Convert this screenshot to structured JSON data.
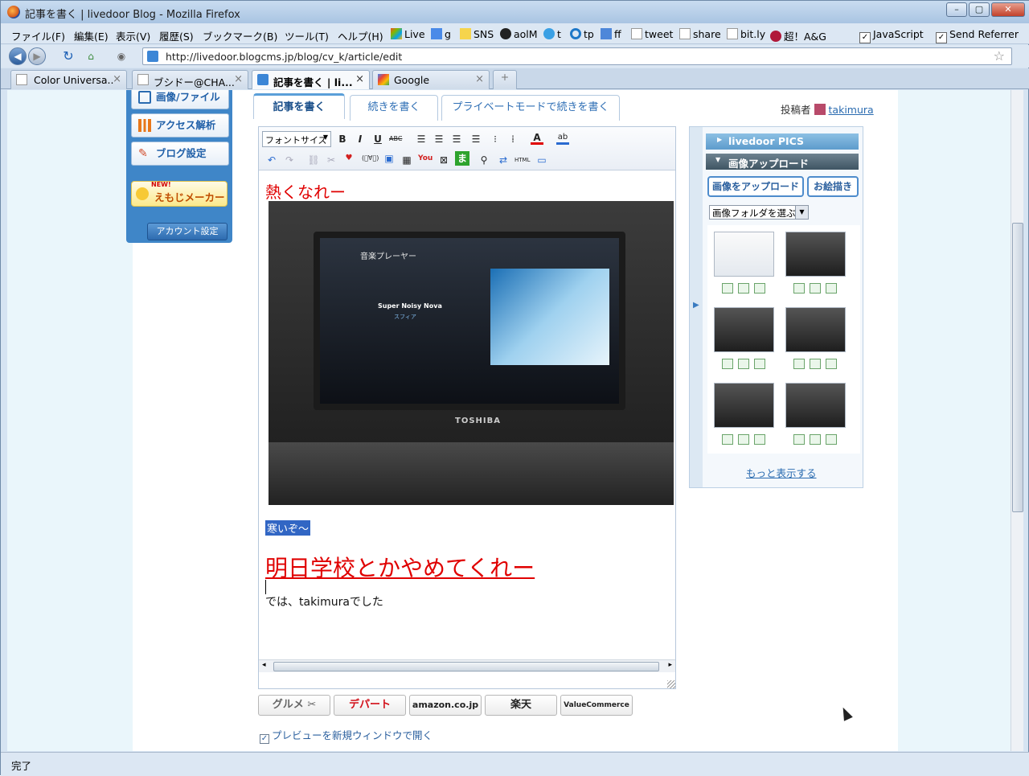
{
  "window": {
    "title": "記事を書く | livedoor Blog - Mozilla Firefox",
    "status": "完了"
  },
  "menu": [
    "ファイル(F)",
    "編集(E)",
    "表示(V)",
    "履歴(S)",
    "ブックマーク(B)",
    "ツール(T)",
    "ヘルプ(H)"
  ],
  "bookmarks": [
    "Live",
    "g",
    "SNS",
    "aolM",
    "t",
    "tp",
    "ff",
    "tweet",
    "share",
    "bit.ly",
    "超！A&G"
  ],
  "bookmark_toggles": [
    "JavaScript",
    "Send Referrer"
  ],
  "url": "http://livedoor.blogcms.jp/blog/cv_k/article/edit",
  "tabs": [
    {
      "label": "Color Universa..."
    },
    {
      "label": "ブシドー@CHA..."
    },
    {
      "label": "記事を書く | li..."
    },
    {
      "label": "Google"
    }
  ],
  "sidebar": {
    "items": [
      "画像/ファイル",
      "アクセス解析",
      "ブログ設定"
    ],
    "emoji": "えもじメーカー",
    "emoji_badge": "NEW!",
    "account": "アカウント設定"
  },
  "main_tabs": [
    "記事を書く",
    "続きを書く",
    "プライベートモードで続きを書く"
  ],
  "author": {
    "label": "投稿者",
    "name": "takimura"
  },
  "editor": {
    "font_size": "フォントサイズ",
    "heading": "熱くなれー",
    "photo": {
      "song": "Super Noisy Nova",
      "artist": "スフィア",
      "app": "音楽プレーヤー",
      "brand": "TOSHIBA"
    },
    "selected_text": "寒いぞ〜",
    "big_text": "明日学校とかやめてくれー",
    "closing": "では、takimuraでした"
  },
  "side": {
    "pics": "livedoor PICS",
    "upload_header": "画像アップロード",
    "upload_button": "画像をアップロード",
    "draw_button": "お絵描き",
    "folder": "画像フォルダを選ぶ",
    "more": "もっと表示する"
  },
  "affiliates": [
    "グルメ",
    "デパート",
    "amazon.co.jp",
    "楽天",
    "ValueCommerce"
  ],
  "preview_option": "プレビューを新規ウィンドウで開く"
}
